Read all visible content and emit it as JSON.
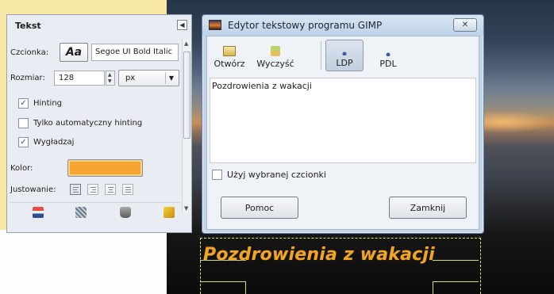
{
  "canvas": {
    "image_text": "Pozdrowienia z wakacji"
  },
  "tool_options": {
    "title": "Tekst",
    "font_label": "Czcionka:",
    "font_preview": "Aa",
    "font_name": "Segoe UI Bold Italic",
    "size_label": "Rozmiar:",
    "size_value": "128",
    "unit_value": "px",
    "hinting_label": "Hinting",
    "hinting_checked": true,
    "auto_hinting_label": "Tylko automatyczny hinting",
    "auto_hinting_checked": false,
    "antialias_label": "Wygładzaj",
    "antialias_checked": true,
    "color_label": "Kolor:",
    "text_color": "#f6a630",
    "justify_label": "Justowanie:",
    "icons": [
      "save-icon",
      "restore-icon",
      "delete-icon",
      "reset-icon"
    ]
  },
  "editor": {
    "title": "Edytor tekstowy programu GIMP",
    "close_glyph": "✕",
    "toolbar": {
      "open_label": "Otwórz",
      "clear_label": "Wyczyść",
      "ltr_label": "LDP",
      "rtl_label": "PDL"
    },
    "text_content": "Pozdrowienia z wakacji",
    "use_font_label": "Użyj wybranej czcionki",
    "use_font_checked": false,
    "help_button": "Pomoc",
    "close_button": "Zamknij"
  }
}
